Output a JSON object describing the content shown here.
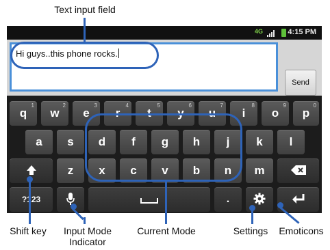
{
  "callouts": {
    "text_input_field": "Text input field",
    "shift_key": "Shift key",
    "input_mode_indicator_line1": "Input Mode",
    "input_mode_indicator_line2": "Indicator",
    "current_mode": "Current Mode",
    "settings": "Settings",
    "emoticons": "Emoticons"
  },
  "status_bar": {
    "time": "4:15 PM",
    "network": "4G"
  },
  "compose": {
    "message": "Hi guys..this phone rocks.",
    "send_label": "Send"
  },
  "keyboard": {
    "row1": [
      {
        "char": "q",
        "num": "1"
      },
      {
        "char": "w",
        "num": "2"
      },
      {
        "char": "e",
        "num": "3"
      },
      {
        "char": "r",
        "num": "4"
      },
      {
        "char": "t",
        "num": "5"
      },
      {
        "char": "y",
        "num": "6"
      },
      {
        "char": "u",
        "num": "7"
      },
      {
        "char": "i",
        "num": "8"
      },
      {
        "char": "o",
        "num": "9"
      },
      {
        "char": "p",
        "num": "0"
      }
    ],
    "row2": [
      "a",
      "s",
      "d",
      "f",
      "g",
      "h",
      "j",
      "k",
      "l"
    ],
    "row3": [
      "z",
      "x",
      "c",
      "v",
      "b",
      "n",
      "m"
    ],
    "mode_key": "?123",
    "period_key": "."
  },
  "colors": {
    "callout_blue": "#2e63b8",
    "field_border": "#4a90d9",
    "key_gray": "#4d4d4d"
  }
}
